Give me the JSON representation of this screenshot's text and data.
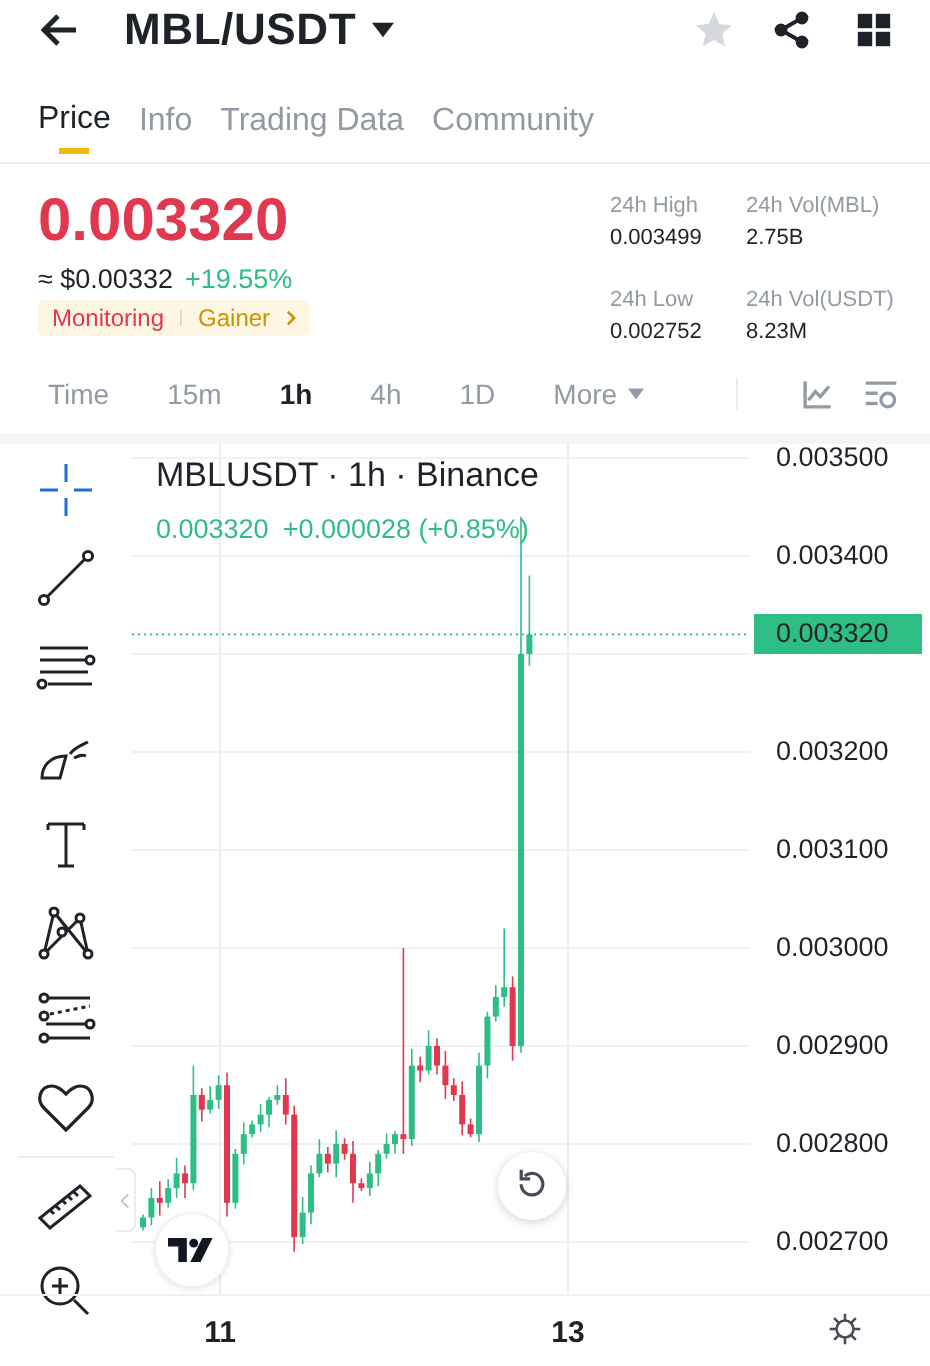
{
  "header": {
    "title": "MBL/USDT",
    "favorited": false
  },
  "tabs": [
    {
      "label": "Price",
      "selected": true
    },
    {
      "label": "Info",
      "selected": false
    },
    {
      "label": "Trading Data",
      "selected": false
    },
    {
      "label": "Community",
      "selected": false
    }
  ],
  "price": {
    "last": "0.003320",
    "usd": "≈ $0.00332",
    "change": "+19.55%",
    "tags": [
      {
        "label": "Monitoring",
        "color": "#e0384f"
      },
      {
        "label": "Gainer",
        "color": "#c99400"
      }
    ]
  },
  "stats": [
    {
      "label": "24h High",
      "value": "0.003499"
    },
    {
      "label": "24h Vol(MBL)",
      "value": "2.75B"
    },
    {
      "label": "24h Low",
      "value": "0.002752"
    },
    {
      "label": "24h Vol(USDT)",
      "value": "8.23M"
    }
  ],
  "intervals": [
    {
      "label": "Time",
      "selected": false
    },
    {
      "label": "15m",
      "selected": false
    },
    {
      "label": "1h",
      "selected": true
    },
    {
      "label": "4h",
      "selected": false
    },
    {
      "label": "1D",
      "selected": false
    },
    {
      "label": "More",
      "selected": false
    }
  ],
  "chart": {
    "title": "MBLUSDT · 1h · Binance",
    "last": "0.003320",
    "change": "+0.000028 (+0.85%)",
    "price_tag": "0.003320",
    "y_labels": [
      "0.003500",
      "0.003400",
      "0.003200",
      "0.003100",
      "0.003000",
      "0.002900",
      "0.002800",
      "0.002700"
    ],
    "x_labels": [
      "11",
      "13"
    ]
  }
}
